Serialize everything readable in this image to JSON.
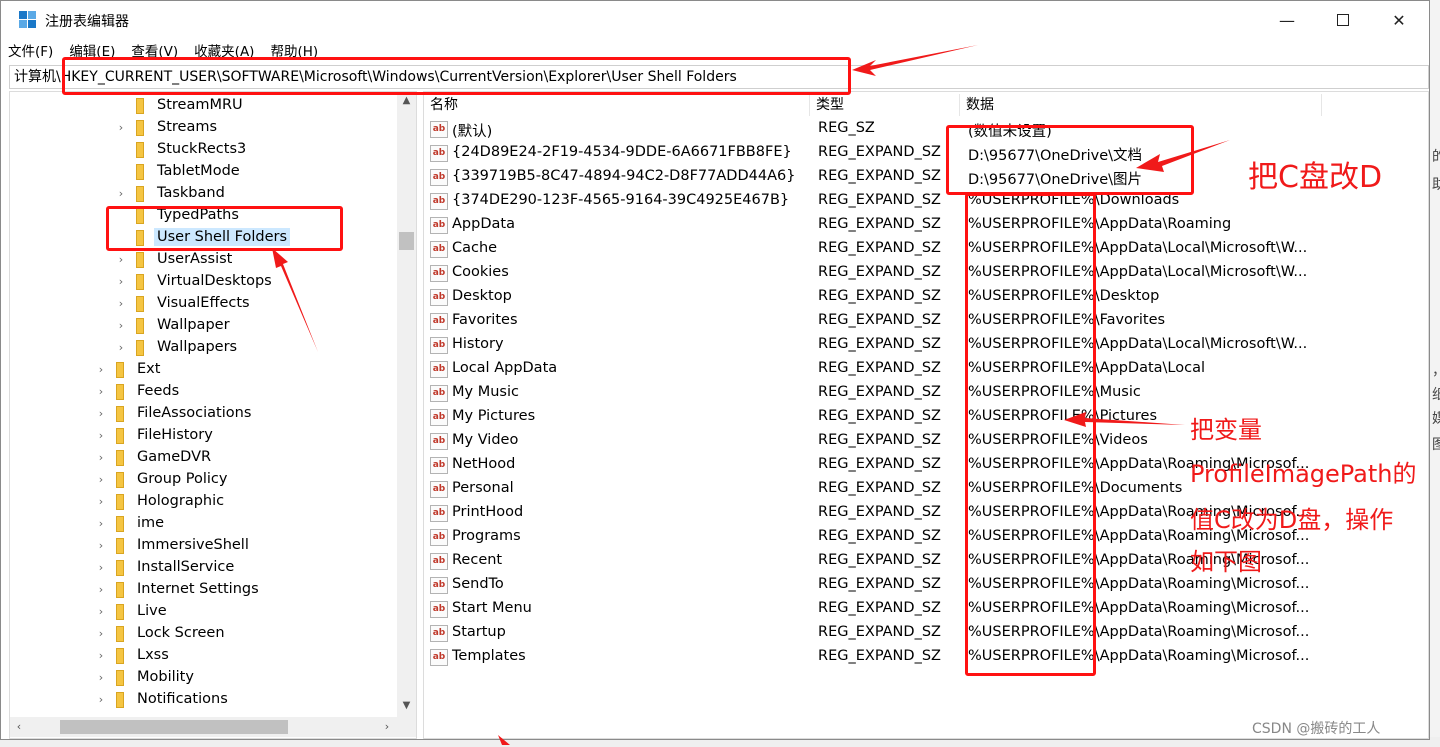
{
  "window": {
    "title": "注册表编辑器",
    "minimize": "—",
    "close": "✕"
  },
  "menu": [
    "文件(F)",
    "编辑(E)",
    "查看(V)",
    "收藏夹(A)",
    "帮助(H)"
  ],
  "address": "计算机\\HKEY_CURRENT_USER\\SOFTWARE\\Microsoft\\Windows\\CurrentVersion\\Explorer\\User Shell Folders",
  "tree": [
    {
      "label": "StreamMRU",
      "level": 1,
      "has_children": false
    },
    {
      "label": "Streams",
      "level": 1,
      "has_children": true
    },
    {
      "label": "StuckRects3",
      "level": 1,
      "has_children": false
    },
    {
      "label": "TabletMode",
      "level": 1,
      "has_children": false
    },
    {
      "label": "Taskband",
      "level": 1,
      "has_children": true
    },
    {
      "label": "TypedPaths",
      "level": 1,
      "has_children": false
    },
    {
      "label": "User Shell Folders",
      "level": 1,
      "has_children": false,
      "selected": true
    },
    {
      "label": "UserAssist",
      "level": 1,
      "has_children": true
    },
    {
      "label": "VirtualDesktops",
      "level": 1,
      "has_children": true
    },
    {
      "label": "VisualEffects",
      "level": 1,
      "has_children": true
    },
    {
      "label": "Wallpaper",
      "level": 1,
      "has_children": true
    },
    {
      "label": "Wallpapers",
      "level": 1,
      "has_children": true
    },
    {
      "label": "Ext",
      "level": 0,
      "has_children": true
    },
    {
      "label": "Feeds",
      "level": 0,
      "has_children": true
    },
    {
      "label": "FileAssociations",
      "level": 0,
      "has_children": true
    },
    {
      "label": "FileHistory",
      "level": 0,
      "has_children": true
    },
    {
      "label": "GameDVR",
      "level": 0,
      "has_children": true
    },
    {
      "label": "Group Policy",
      "level": 0,
      "has_children": true
    },
    {
      "label": "Holographic",
      "level": 0,
      "has_children": true
    },
    {
      "label": "ime",
      "level": 0,
      "has_children": true
    },
    {
      "label": "ImmersiveShell",
      "level": 0,
      "has_children": true
    },
    {
      "label": "InstallService",
      "level": 0,
      "has_children": true
    },
    {
      "label": "Internet Settings",
      "level": 0,
      "has_children": true
    },
    {
      "label": "Live",
      "level": 0,
      "has_children": true
    },
    {
      "label": "Lock Screen",
      "level": 0,
      "has_children": true
    },
    {
      "label": "Lxss",
      "level": 0,
      "has_children": true
    },
    {
      "label": "Mobility",
      "level": 0,
      "has_children": true
    },
    {
      "label": "Notifications",
      "level": 0,
      "has_children": true
    }
  ],
  "columns": [
    "名称",
    "类型",
    "数据"
  ],
  "values": [
    {
      "name": "(默认)",
      "type": "REG_SZ",
      "data": "(数值未设置)"
    },
    {
      "name": "{24D89E24-2F19-4534-9DDE-6A6671FBB8FE}",
      "type": "REG_EXPAND_SZ",
      "data": "D:\\95677\\OneDrive\\文档"
    },
    {
      "name": "{339719B5-8C47-4894-94C2-D8F77ADD44A6}",
      "type": "REG_EXPAND_SZ",
      "data": "D:\\95677\\OneDrive\\图片"
    },
    {
      "name": "{374DE290-123F-4565-9164-39C4925E467B}",
      "type": "REG_EXPAND_SZ",
      "data": "%USERPROFILE%\\Downloads"
    },
    {
      "name": "AppData",
      "type": "REG_EXPAND_SZ",
      "data": "%USERPROFILE%\\AppData\\Roaming"
    },
    {
      "name": "Cache",
      "type": "REG_EXPAND_SZ",
      "data": "%USERPROFILE%\\AppData\\Local\\Microsoft\\W..."
    },
    {
      "name": "Cookies",
      "type": "REG_EXPAND_SZ",
      "data": "%USERPROFILE%\\AppData\\Local\\Microsoft\\W..."
    },
    {
      "name": "Desktop",
      "type": "REG_EXPAND_SZ",
      "data": "%USERPROFILE%\\Desktop"
    },
    {
      "name": "Favorites",
      "type": "REG_EXPAND_SZ",
      "data": "%USERPROFILE%\\Favorites"
    },
    {
      "name": "History",
      "type": "REG_EXPAND_SZ",
      "data": "%USERPROFILE%\\AppData\\Local\\Microsoft\\W..."
    },
    {
      "name": "Local AppData",
      "type": "REG_EXPAND_SZ",
      "data": "%USERPROFILE%\\AppData\\Local"
    },
    {
      "name": "My Music",
      "type": "REG_EXPAND_SZ",
      "data": "%USERPROFILE%\\Music"
    },
    {
      "name": "My Pictures",
      "type": "REG_EXPAND_SZ",
      "data": "%USERPROFILE%\\Pictures"
    },
    {
      "name": "My Video",
      "type": "REG_EXPAND_SZ",
      "data": "%USERPROFILE%\\Videos"
    },
    {
      "name": "NetHood",
      "type": "REG_EXPAND_SZ",
      "data": "%USERPROFILE%\\AppData\\Roaming\\Microsof..."
    },
    {
      "name": "Personal",
      "type": "REG_EXPAND_SZ",
      "data": "%USERPROFILE%\\Documents"
    },
    {
      "name": "PrintHood",
      "type": "REG_EXPAND_SZ",
      "data": "%USERPROFILE%\\AppData\\Roaming\\Microsof..."
    },
    {
      "name": "Programs",
      "type": "REG_EXPAND_SZ",
      "data": "%USERPROFILE%\\AppData\\Roaming\\Microsof..."
    },
    {
      "name": "Recent",
      "type": "REG_EXPAND_SZ",
      "data": "%USERPROFILE%\\AppData\\Roaming\\Microsof..."
    },
    {
      "name": "SendTo",
      "type": "REG_EXPAND_SZ",
      "data": "%USERPROFILE%\\AppData\\Roaming\\Microsof..."
    },
    {
      "name": "Start Menu",
      "type": "REG_EXPAND_SZ",
      "data": "%USERPROFILE%\\AppData\\Roaming\\Microsof..."
    },
    {
      "name": "Startup",
      "type": "REG_EXPAND_SZ",
      "data": "%USERPROFILE%\\AppData\\Roaming\\Microsof..."
    },
    {
      "name": "Templates",
      "type": "REG_EXPAND_SZ",
      "data": "%USERPROFILE%\\AppData\\Roaming\\Microsof..."
    }
  ],
  "annotations": {
    "c_to_d": "把C盘改D",
    "change_var_line1": "把变量",
    "change_var_line2": "ProfileImagePath的",
    "change_var_line3": "值C改为D盘，操作",
    "change_var_line4": "如下图",
    "color": "#f01a1a"
  },
  "watermark": "CSDN @搬砖的工人",
  "icons": {
    "app": "registry-editor-icon",
    "folder": "folder-icon",
    "value": "string-value-icon",
    "expand": "chevron-right-icon"
  }
}
